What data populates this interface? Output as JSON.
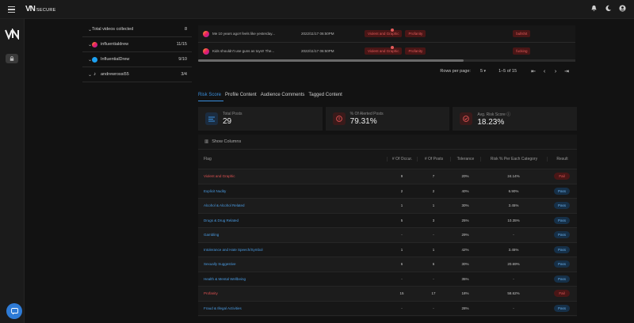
{
  "app": {
    "logo_mark": "VN",
    "logo_text": "SECURE"
  },
  "social_accounts": [
    {
      "icon": "chevron-down",
      "label": "Total videos collected",
      "count": "8",
      "platform": "none"
    },
    {
      "icon": "instagram-icon",
      "label": "influentialdrew",
      "count": "11/15",
      "platform": "instagram"
    },
    {
      "icon": "twitter-icon",
      "label": "InfluentialDrew",
      "count": "9/10",
      "platform": "twitter"
    },
    {
      "icon": "tiktok-icon",
      "label": "andrewrossi55",
      "count": "3/4",
      "platform": "tiktok"
    }
  ],
  "posts": [
    {
      "text": "Me 10 years ago!! feels like yesterday...",
      "date": "2022/11/17 06:50PM",
      "tags": [
        "Violent and Graphic",
        "Profanity"
      ],
      "extra_tag": "bullshit"
    },
    {
      "text": "Kids shouldn't use guns as toys!! The...",
      "date": "2022/11/17 06:50PM",
      "tags": [
        "Violent and Graphic",
        "Profanity"
      ],
      "extra_tag": "fucking"
    }
  ],
  "pager": {
    "rows_label": "Rows per page:",
    "rows_value": "5",
    "range": "1–5 of 15"
  },
  "tabs": [
    {
      "label": "Risk Score",
      "active": true
    },
    {
      "label": "Profile Content",
      "active": false
    },
    {
      "label": "Audience Comments",
      "active": false
    },
    {
      "label": "Tagged Content",
      "active": false
    }
  ],
  "stats": [
    {
      "label": "Total Posts",
      "value": "29",
      "icon": "list-icon",
      "color": "#3a8fde",
      "bg": "#1b2c40"
    },
    {
      "label": "% Of Alerted Posts",
      "value": "79.31%",
      "icon": "alert-icon",
      "color": "#e05252",
      "bg": "#3a1a1a"
    },
    {
      "label": "Avg. Risk Score",
      "value": "18.23%",
      "icon": "check-circle-icon",
      "color": "#e05252",
      "bg": "#3a1a1a"
    }
  ],
  "table": {
    "show_columns": "Show Columns",
    "headers": {
      "flag": "Flag",
      "occ": "# Of Occur.",
      "posts": "# Of Posts",
      "tol": "Tolerance",
      "risk": "Risk % Per Each Category",
      "res": "Result"
    },
    "rows": [
      {
        "flag": "Violent and Graphic",
        "occ": "9",
        "posts": "7",
        "tol": "20%",
        "risk": "24.14%",
        "result": "Fail"
      },
      {
        "flag": "Explicit Nudity",
        "occ": "2",
        "posts": "2",
        "tol": "40%",
        "risk": "6.90%",
        "result": "Pass"
      },
      {
        "flag": "Alcohol & Alcohol Related",
        "occ": "1",
        "posts": "1",
        "tol": "30%",
        "risk": "3.45%",
        "result": "Pass"
      },
      {
        "flag": "Drugs & Drug Related",
        "occ": "5",
        "posts": "3",
        "tol": "25%",
        "risk": "10.35%",
        "result": "Pass"
      },
      {
        "flag": "Gambling",
        "occ": "-",
        "posts": "-",
        "tol": "29%",
        "risk": "-",
        "result": "Pass"
      },
      {
        "flag": "Intolerance and Hate Speech/Symbol",
        "occ": "1",
        "posts": "1",
        "tol": "42%",
        "risk": "3.45%",
        "result": "Pass"
      },
      {
        "flag": "Sexually Suggestive",
        "occ": "6",
        "posts": "6",
        "tol": "30%",
        "risk": "20.69%",
        "result": "Pass"
      },
      {
        "flag": "Health & Mental Wellbeing",
        "occ": "-",
        "posts": "-",
        "tol": "35%",
        "risk": "-",
        "result": "Pass"
      },
      {
        "flag": "Profanity",
        "occ": "15",
        "posts": "17",
        "tol": "18%",
        "risk": "58.62%",
        "result": "Fail"
      },
      {
        "flag": "Fraud & Illegal Activities",
        "occ": "-",
        "posts": "-",
        "tol": "28%",
        "risk": "-",
        "result": "Pass"
      }
    ]
  }
}
